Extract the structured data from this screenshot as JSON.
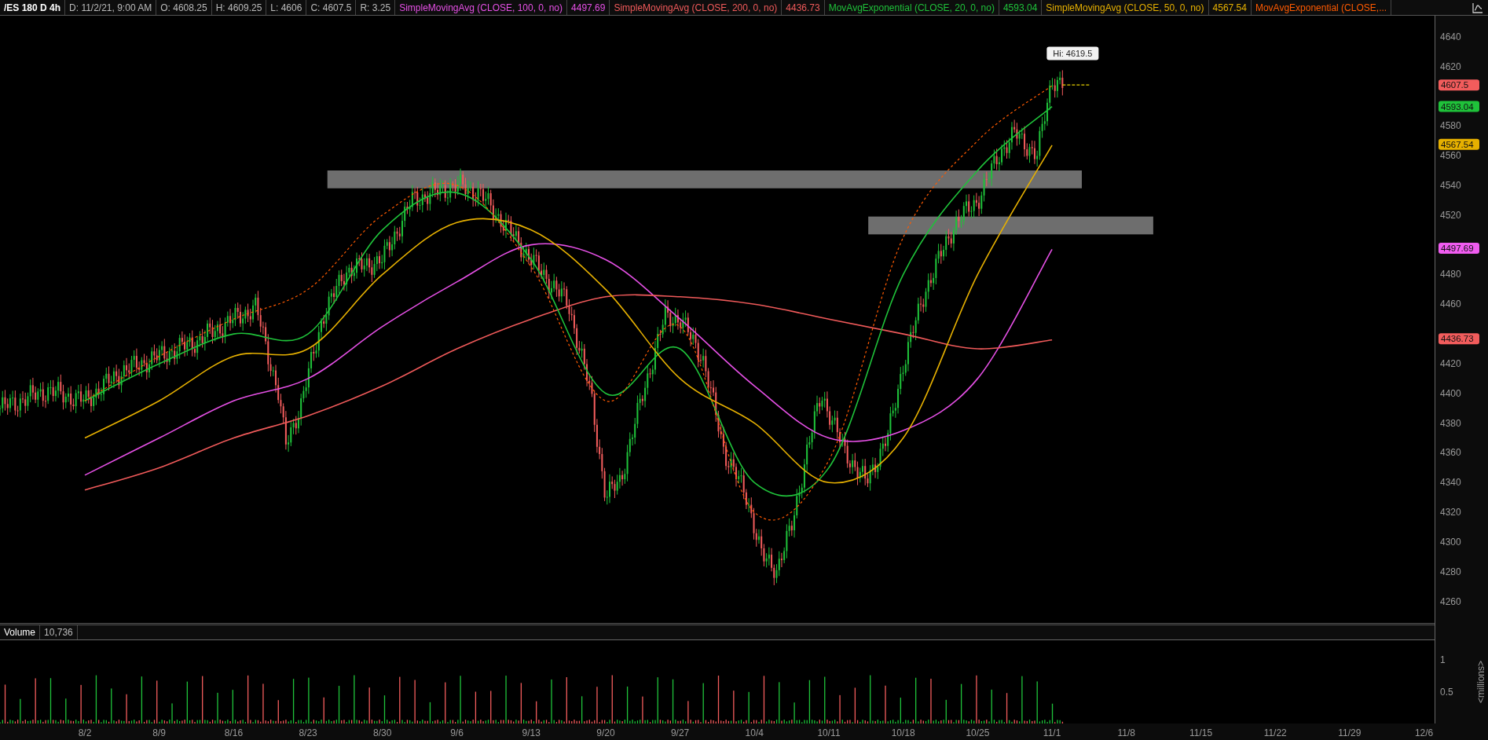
{
  "header": {
    "symbol": "/ES 180 D 4h",
    "fields": [
      "D: 11/2/21, 9:00 AM",
      "O: 4608.25",
      "H: 4609.25",
      "L: 4606",
      "C: 4607.5",
      "R: 3.25"
    ],
    "studies": [
      {
        "label": "SimpleMovingAvg (CLOSE, 100, 0, no)",
        "value": "4497.69",
        "color": "#e650e6"
      },
      {
        "label": "SimpleMovingAvg (CLOSE, 200, 0, no)",
        "value": "4436.73",
        "color": "#f05a5a"
      },
      {
        "label": "MovAvgExponential (CLOSE, 20, 0, no)",
        "value": "4593.04",
        "color": "#1fc23a"
      },
      {
        "label": "SimpleMovingAvg (CLOSE, 50, 0, no)",
        "value": "4567.54",
        "color": "#e6b000"
      },
      {
        "label": "MovAvgExponential (CLOSE,...",
        "color": "#ff5a00"
      }
    ]
  },
  "price_chart": {
    "high_label": "Hi: 4619.5",
    "price_tags": [
      {
        "value": "4607.5",
        "color": "#f25c5c"
      },
      {
        "value": "4593.04",
        "color": "#1fc23a"
      },
      {
        "value": "4567.54",
        "color": "#e6b000"
      },
      {
        "value": "4497.69",
        "color": "#f05cf0"
      },
      {
        "value": "4436.73",
        "color": "#f25c5c"
      }
    ],
    "price_axis": [
      "4640",
      "4620",
      "4580",
      "4560",
      "4540",
      "4520",
      "4480",
      "4460",
      "4420",
      "4400",
      "4380",
      "4360",
      "4340",
      "4320",
      "4300",
      "4280",
      "4260"
    ]
  },
  "volume": {
    "title": "Volume",
    "value": "10,736",
    "axis": [
      "1",
      "0.5"
    ],
    "unit": "<millions>"
  },
  "date_axis": [
    "8/2",
    "8/9",
    "8/16",
    "8/23",
    "8/30",
    "9/6",
    "9/13",
    "9/20",
    "9/27",
    "10/4",
    "10/11",
    "10/18",
    "10/25",
    "11/1",
    "11/8",
    "11/15",
    "11/22",
    "11/29",
    "12/6"
  ]
}
